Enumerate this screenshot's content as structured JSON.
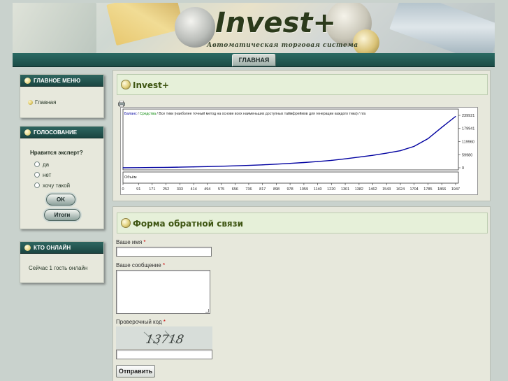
{
  "header": {
    "title": "Invest+",
    "slogan": "Автоматическая торговая система"
  },
  "nav": {
    "home_label": "ГЛАВНАЯ"
  },
  "sidebar": {
    "main_menu": {
      "title": "ГЛАВНОЕ МЕНЮ",
      "items": [
        "Главная"
      ]
    },
    "poll": {
      "title": "ГОЛОСОВАНИЕ",
      "question": "Нравится эксперт?",
      "options": [
        "да",
        "нет",
        "хочу такой"
      ],
      "vote_label": "OK",
      "results_label": "Итоги"
    },
    "online": {
      "title": "КТО ОНЛАЙН",
      "text": "Сейчас 1 гость онлайн"
    }
  },
  "article": {
    "title": "Invest+",
    "print_icon": "printer-icon"
  },
  "chart_data": {
    "type": "line",
    "legend": {
      "balance": "Баланс",
      "equity": "Средства",
      "desc": "Все тики (наиболее точный метод на основе всех наименьших доступных таймфреймов для генерации каждого тика)",
      "na": "n/a"
    },
    "volume_label": "Объём",
    "x_ticks": [
      "0",
      "91",
      "171",
      "252",
      "333",
      "414",
      "494",
      "575",
      "656",
      "736",
      "817",
      "898",
      "978",
      "1059",
      "1140",
      "1220",
      "1301",
      "1382",
      "1462",
      "1543",
      "1624",
      "1704",
      "1785",
      "1866",
      "1947"
    ],
    "y_ticks": [
      "239921",
      "179941",
      "119960",
      "59980",
      "0"
    ],
    "ylim": [
      0,
      239921
    ],
    "xlim": [
      0,
      1947
    ],
    "series": [
      {
        "name": "Баланс",
        "color": "#0000a0",
        "x": [
          0,
          91,
          171,
          252,
          333,
          414,
          494,
          575,
          656,
          736,
          817,
          898,
          978,
          1059,
          1140,
          1220,
          1301,
          1382,
          1462,
          1543,
          1624,
          1704,
          1785,
          1866,
          1947
        ],
        "values": [
          0,
          500,
          1200,
          2000,
          3000,
          4000,
          5500,
          7000,
          9000,
          11000,
          13500,
          16500,
          20000,
          24000,
          28500,
          34000,
          41000,
          49000,
          57000,
          67000,
          78000,
          98000,
          133000,
          185000,
          235000
        ]
      }
    ]
  },
  "contact": {
    "title": "Форма обратной связи",
    "name_label": "Ваше имя",
    "message_label": "Ваше сообщение",
    "captcha_label": "Проверочный код",
    "captcha_text": "13718",
    "required_mark": "*",
    "submit_label": "Отправить"
  }
}
